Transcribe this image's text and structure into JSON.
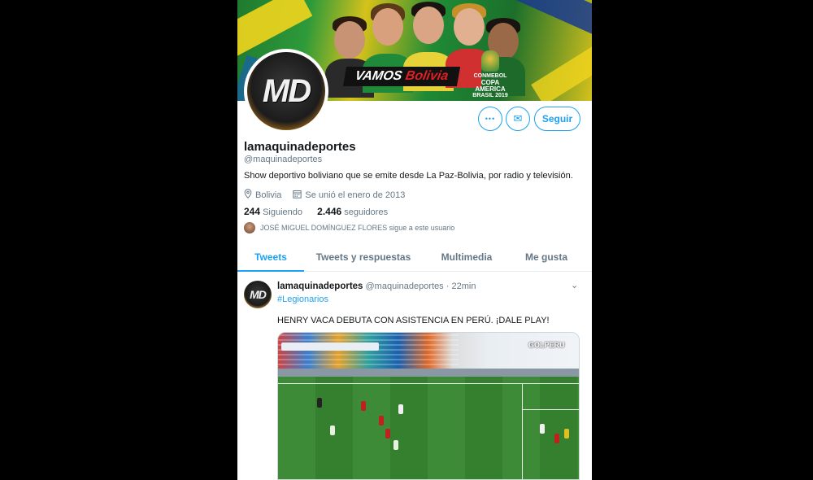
{
  "banner": {
    "vamos_prefix": "VAMOS ",
    "vamos_highlight": "Bolivia",
    "copa_line1": "CONMEBOL",
    "copa_line2": "COPA AMERICA",
    "copa_line3": "BRASIL 2019"
  },
  "profile": {
    "avatar_logo": "MD",
    "display_name": "lamaquinadeportes",
    "handle": "@maquinadeportes",
    "bio": "Show deportivo boliviano que se emite desde La Paz-Bolivia, por radio y televisión.",
    "location": "Bolivia",
    "joined": "Se unió el enero de 2013",
    "following_count": "244",
    "following_label": "Siguiendo",
    "followers_count": "2.446",
    "followers_label": "seguidores",
    "followed_by": "JOSÉ MIGUEL DOMÍNGUEZ FLORES sigue a este usuario"
  },
  "actions": {
    "more_icon": "•••",
    "message_icon": "✉",
    "follow_label": "Seguir"
  },
  "tabs": [
    {
      "label": "Tweets",
      "active": true
    },
    {
      "label": "Tweets y respuestas",
      "active": false
    },
    {
      "label": "Multimedia",
      "active": false
    },
    {
      "label": "Me gusta",
      "active": false
    }
  ],
  "tweet": {
    "avatar_logo": "MD",
    "author_name": "lamaquinadeportes",
    "author_handle": "@maquinadeportes",
    "separator": "·",
    "time": "22min",
    "chevron": "⌄",
    "hashtag": "#Legionarios",
    "text": "HENRY VACA DEBUTA CON ASISTENCIA EN PERÚ. ¡DALE PLAY!",
    "video_overlay": "GOLPERU"
  },
  "colors": {
    "accent": "#1da1f2",
    "muted": "#657786",
    "text": "#14171a"
  }
}
